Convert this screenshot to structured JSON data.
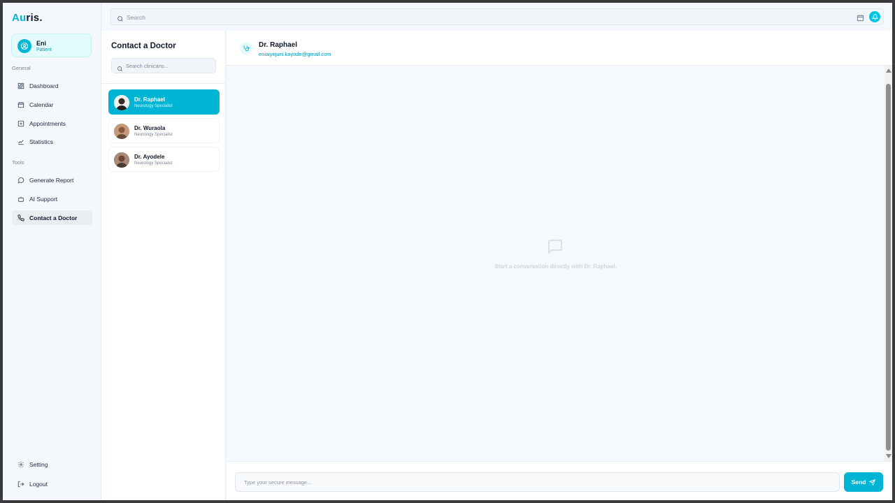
{
  "app": {
    "logo_accent": "Au",
    "logo_rest": "ris."
  },
  "user": {
    "name": "Eni",
    "role": "Patient"
  },
  "sidebar": {
    "general_label": "General",
    "tools_label": "Tools",
    "general_items": [
      {
        "label": "Dashboard",
        "icon": "grid-icon"
      },
      {
        "label": "Calendar",
        "icon": "calendar-icon"
      },
      {
        "label": "Appointments",
        "icon": "plus-square-icon"
      },
      {
        "label": "Statistics",
        "icon": "chart-icon"
      }
    ],
    "tool_items": [
      {
        "label": "Generate Report",
        "icon": "message-circle-icon"
      },
      {
        "label": "AI Support",
        "icon": "bot-icon"
      },
      {
        "label": "Contact a Doctor",
        "icon": "phone-icon",
        "active": true
      }
    ],
    "bottom_items": [
      {
        "label": "Setting",
        "icon": "gear-icon"
      },
      {
        "label": "Logout",
        "icon": "logout-icon"
      }
    ]
  },
  "topbar": {
    "search_placeholder": "Search"
  },
  "doctors_panel": {
    "title": "Contact a Doctor",
    "search_placeholder": "Search clinicans...",
    "doctors": [
      {
        "name": "Dr. Raphael",
        "specialty": "Neurology Specialist",
        "active": true
      },
      {
        "name": "Dr. Wuraola",
        "specialty": "Neurology Specialist",
        "active": false
      },
      {
        "name": "Dr. Ayodele",
        "specialty": "Neurology Specialist",
        "active": false
      }
    ]
  },
  "chat": {
    "doctor_name": "Dr. Raphael",
    "doctor_email": "eniaiyejuni.kayode@gmail.com",
    "empty_text": "Start a conversation directly with Dr. Raphael.",
    "message_placeholder": "Type your secure message...",
    "send_label": "Send"
  },
  "colors": {
    "accent": "#00b5d3",
    "active_nav_bg": "#eaeef3",
    "user_card_bg": "#e4fbfd"
  }
}
